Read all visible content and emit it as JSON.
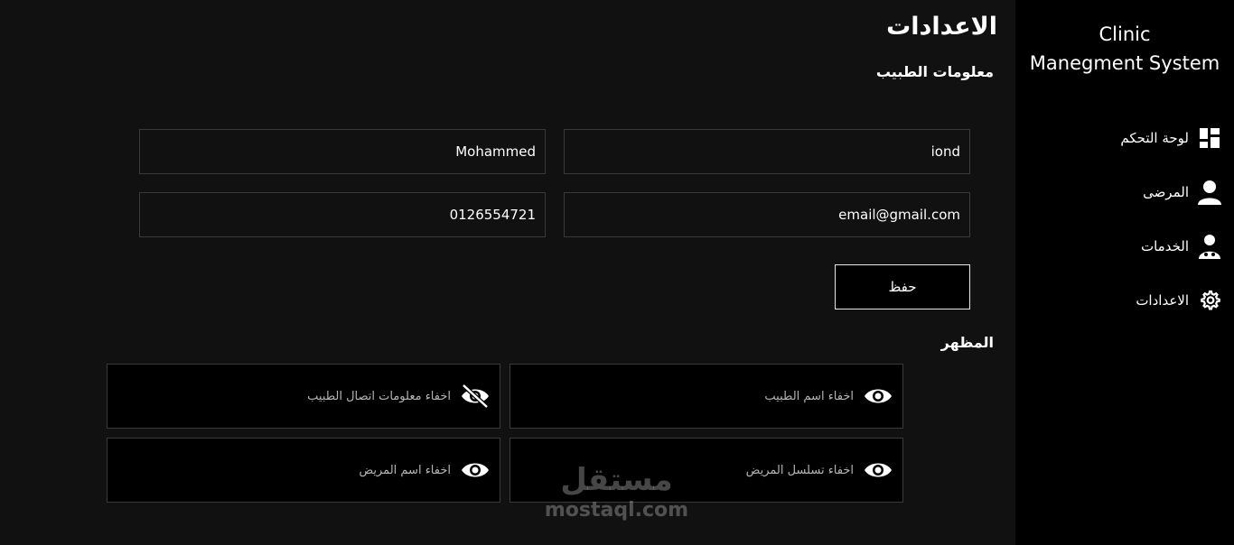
{
  "sidebar": {
    "brand_line1": "Clinic",
    "brand_line2": "Manegment System",
    "items": [
      {
        "label": "لوحة التحكم",
        "icon": "dashboard-icon"
      },
      {
        "label": "المرضى",
        "icon": "user-icon"
      },
      {
        "label": "الخدمات",
        "icon": "doctor-icon"
      },
      {
        "label": "الاعدادات",
        "icon": "gear-icon"
      }
    ]
  },
  "main": {
    "title": "الاعدادات",
    "doctor_section_title": "معلومات الطبيب",
    "fields": {
      "first_name": "iond",
      "last_name": "Mohammed",
      "email": "email@gmail.com",
      "phone": "0126554721"
    },
    "save_label": "حفظ",
    "appearance_title": "المظهر",
    "toggles": [
      {
        "label": "اخفاء اسم الطبيب",
        "icon": "eye-icon"
      },
      {
        "label": "اخفاء معلومات اتصال الطبيب",
        "icon": "eye-slash-icon"
      },
      {
        "label": "اخفاء تسلسل المريض",
        "icon": "eye-icon"
      },
      {
        "label": "اخفاء اسم المريض",
        "icon": "eye-icon"
      }
    ]
  },
  "watermark": {
    "arabic": "مستقل",
    "latin": "mostaql.com"
  },
  "colors": {
    "background": "#111111",
    "sidebar": "#000000",
    "card": "#000000",
    "border": "#3a3a3a"
  }
}
